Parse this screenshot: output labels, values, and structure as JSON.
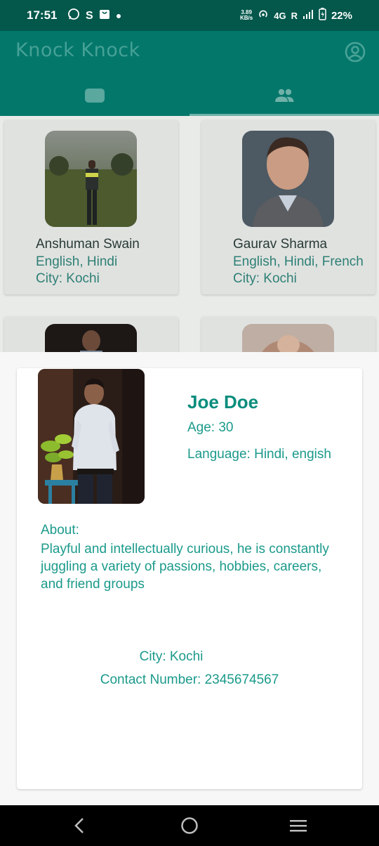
{
  "status_bar": {
    "time": "17:51",
    "speed_value": "3.89",
    "speed_unit": "KB/s",
    "network": "4G",
    "roaming": "R",
    "battery": "22%"
  },
  "app": {
    "title": "Knock Knock"
  },
  "tabs": [
    {
      "icon": "chat-bubble-icon",
      "selected": false
    },
    {
      "icon": "people-icon",
      "selected": true
    }
  ],
  "people": [
    {
      "name": "Anshuman Swain",
      "languages": "English, Hindi",
      "city": "City: Kochi"
    },
    {
      "name": "Gaurav Sharma",
      "languages": "English, Hindi, French",
      "city": "City: Kochi"
    }
  ],
  "detail": {
    "name": "Joe Doe",
    "age": "Age: 30",
    "language": "Language: Hindi, engish",
    "about_label": "About:",
    "about_text": "Playful and intellectually curious, he is constantly juggling a variety of passions, hobbies, careers, and friend groups",
    "city": "City: Kochi",
    "contact": "Contact Number: 2345674567"
  },
  "colors": {
    "status_bar": "#03574b",
    "app_bar": "#04776b",
    "accent_text": "#1b9a8b"
  }
}
